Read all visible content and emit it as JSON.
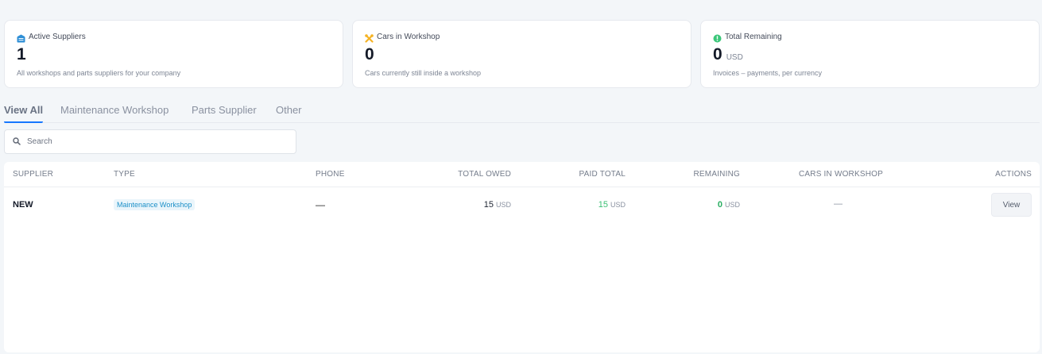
{
  "cards": [
    {
      "icon": "building-icon",
      "title": "Active Suppliers",
      "value": "1",
      "unit": "",
      "description": "All workshops and parts suppliers for your company"
    },
    {
      "icon": "wrench-icon",
      "title": "Cars in Workshop",
      "value": "0",
      "unit": "",
      "description": "Cars currently still inside a workshop"
    },
    {
      "icon": "info-circle-icon",
      "title": "Total Remaining",
      "value": "0",
      "unit": "USD",
      "description": "Invoices – payments, per currency"
    }
  ],
  "tabs": [
    "View All",
    "Maintenance Workshop",
    "Parts Supplier",
    "Other"
  ],
  "active_tab": "View All",
  "search": {
    "placeholder": "Search",
    "value": ""
  },
  "table": {
    "headers": {
      "supplier": "SUPPLIER",
      "type": "TYPE",
      "phone": "PHONE",
      "total_owed": "TOTAL OWED",
      "paid_total": "PAID TOTAL",
      "remaining": "REMAINING",
      "cars_in_workshop": "CARS IN WORKSHOP",
      "actions": "ACTIONS"
    },
    "rows": [
      {
        "supplier": "NEW",
        "type": "Maintenance Workshop",
        "phone": "—",
        "total_owed": "15",
        "total_owed_currency": "USD",
        "paid_total": "15",
        "paid_total_currency": "USD",
        "remaining": "0",
        "remaining_currency": "USD",
        "cars_in_workshop": "—",
        "action_label": "View"
      }
    ]
  },
  "colors": {
    "accent": "#1677ff",
    "paid_green": "#3bbf74",
    "badge_blue": "#1d90c8",
    "card_icon_blue": "#2f8fd6",
    "card_icon_orange": "#f5b324",
    "card_icon_green": "#3cc77a"
  }
}
